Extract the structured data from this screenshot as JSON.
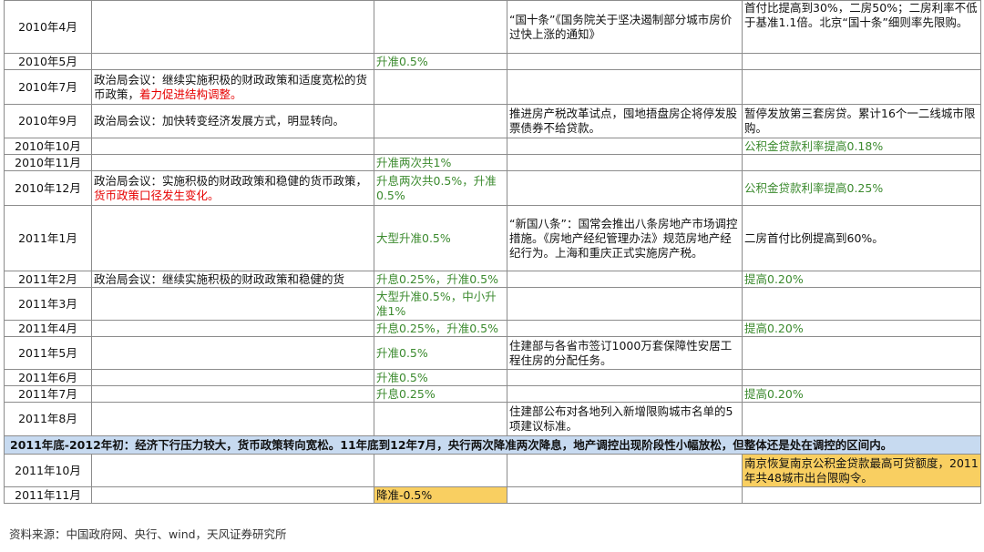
{
  "rows": [
    {
      "date": "2010年4月",
      "politburo": "",
      "monetary": "",
      "policy": "“国十条”《国务院关于坚决遏制部分城市房价过快上涨的通知》",
      "credit": "首付比提高到30%，二房50%；二房利率不低于基准1.1倍。北京“国十条”细则率先限购。"
    },
    {
      "date": "2010年5月",
      "politburo": "",
      "monetary": "升准0.5%",
      "policy": "",
      "credit": ""
    },
    {
      "date": "2010年7月",
      "politburo": "政治局会议：继续实施积极的财政政策和适度宽松的货币政策，",
      "politburo_red": "着力促进结构调整。",
      "monetary": "",
      "policy": "",
      "credit": ""
    },
    {
      "date": "2010年9月",
      "politburo": "政治局会议：加快转变经济发展方式，明显转向。",
      "monetary": "",
      "policy": "推进房产税改革试点，囤地捂盘房企将停发股票债券不给贷款。",
      "credit": "暂停发放第三套房贷。累计16个一二线城市限购。"
    },
    {
      "date": "2010年10月",
      "politburo": "",
      "monetary": "",
      "policy": "",
      "credit": "公积金贷款利率提高0.18%"
    },
    {
      "date": "2010年11月",
      "politburo": "",
      "monetary": "升准两次共1%",
      "policy": "",
      "credit": ""
    },
    {
      "date": "2010年12月",
      "politburo": "政治局会议：实施积极的财政政策和稳健的货币政策，",
      "politburo_red": "货币政策口径发生变化。",
      "monetary": "升息两次共0.5%，升准0.5%",
      "policy": "",
      "credit": "公积金贷款利率提高0.25%"
    },
    {
      "date": "2011年1月",
      "politburo": "",
      "monetary": "大型升准0.5%",
      "policy": "“新国八条”：国常会推出八条房地产市场调控措施。《房地产经纪管理办法》规范房地产经纪行为。上海和重庆正式实施房产税。",
      "credit": "二房首付比例提高到60%。"
    },
    {
      "date": "2011年2月",
      "politburo": "政治局会议：继续实施积极的财政政策和稳健的货",
      "monetary": "升息0.25%，升准0.5%",
      "policy": "",
      "credit": "提高0.20%"
    },
    {
      "date": "2011年3月",
      "politburo": "",
      "monetary": "大型升准0.5%，中小升准1%",
      "policy": "",
      "credit": ""
    },
    {
      "date": "2011年4月",
      "politburo": "",
      "monetary": "升息0.25%，升准0.5%",
      "policy": "",
      "credit": "提高0.20%"
    },
    {
      "date": "2011年5月",
      "politburo": "",
      "monetary": "升准0.5%",
      "policy": "住建部与各省市签订1000万套保障性安居工程住房的分配任务。",
      "credit": ""
    },
    {
      "date": "2011年6月",
      "politburo": "",
      "monetary": "升准0.5%",
      "policy": "",
      "credit": ""
    },
    {
      "date": "2011年7月",
      "politburo": "",
      "monetary": "升息0.25%",
      "policy": "",
      "credit": "提高0.20%"
    },
    {
      "date": "2011年8月",
      "politburo": "",
      "monetary": "",
      "policy": "住建部公布对各地列入新增限购城市名单的5项建议标准。",
      "credit": ""
    }
  ],
  "banner": "2011年底-2012年初：经济下行压力较大，货币政策转向宽松。11年底到12年7月，央行两次降准两次降息，地产调控出现阶段性小幅放松，但整体还是处在调控的区间内。",
  "rows2": [
    {
      "date": "2011年10月",
      "politburo": "",
      "monetary": "",
      "policy": "",
      "credit": "南京恢复南京公积金贷款最高可贷额度，2011年共48城市出台限购令。"
    },
    {
      "date": "2011年11月",
      "politburo": "",
      "monetary": "降准-0.5%",
      "policy": "",
      "credit": ""
    }
  ],
  "source": "资料来源：中国政府网、央行、wind，天风证券研究所",
  "colors": {
    "green_text": "#3b8a2e",
    "red_text": "#e60000",
    "banner_bg": "#c7daf0",
    "highlight_bg": "#f9cf61",
    "border": "#8c8c8c"
  }
}
